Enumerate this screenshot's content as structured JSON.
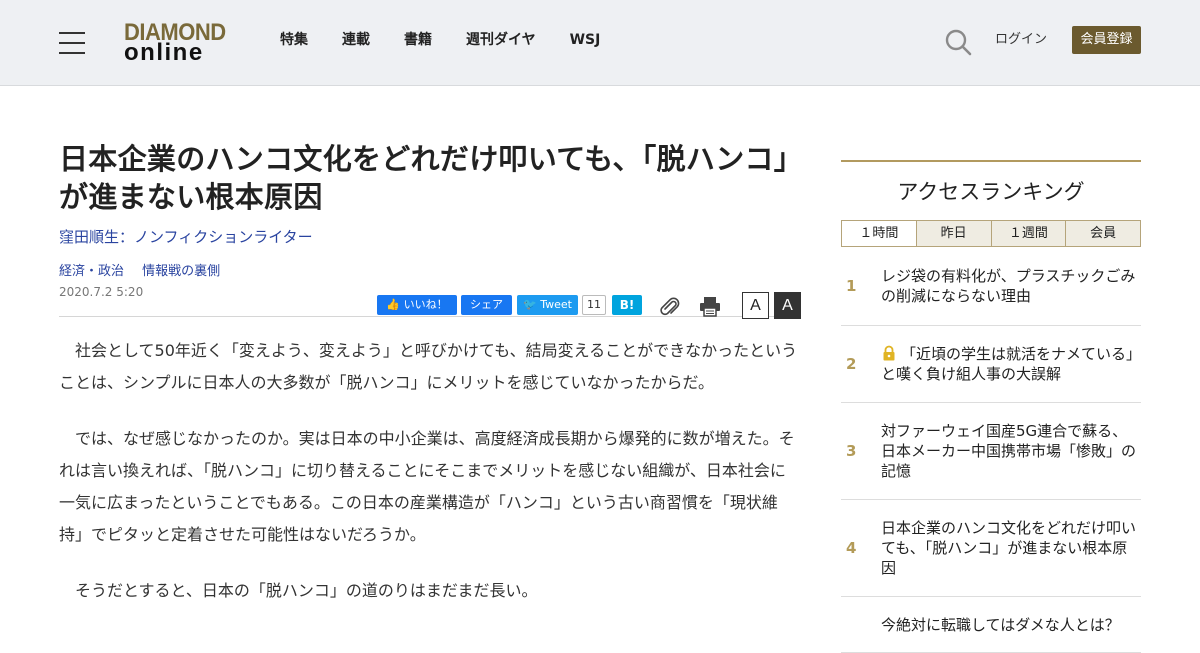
{
  "header": {
    "logo_top": "DIAMOND",
    "logo_bottom": "online",
    "nav": [
      "特集",
      "連載",
      "書籍",
      "週刊ダイヤ",
      "WSJ"
    ],
    "login": "ログイン",
    "register": "会員登録"
  },
  "article": {
    "title": "日本企業のハンコ文化をどれだけ叩いても、「脱ハンコ」が進まない根本原因",
    "author": "窪田順生：ノンフィクションライター",
    "tags": [
      "経済・政治",
      "情報戦の裏側"
    ],
    "date": "2020.7.2 5:20",
    "share": {
      "like": "いいね！",
      "fb_share": "シェア",
      "tweet": "Tweet",
      "tweet_count": "11",
      "hatena": "B!"
    },
    "font_size_small": "A",
    "font_size_large": "A",
    "paragraphs": [
      "社会として50年近く「変えよう、変えよう」と呼びかけても、結局変えることができなかったということは、シンプルに日本人の大多数が「脱ハンコ」にメリットを感じていなかったからだ。",
      "では、なぜ感じなかったのか。実は日本の中小企業は、高度経済成長期から爆発的に数が増えた。それは言い換えれば、「脱ハンコ」に切り替えることにそこまでメリットを感じない組織が、日本社会に一気に広まったということでもある。この日本の産業構造が「ハンコ」という古い商習慣を「現状維持」でピタッと定着させた可能性はないだろうか。",
      "そうだとすると、日本の「脱ハンコ」の道のりはまだまだ長い。"
    ]
  },
  "ranking": {
    "title": "アクセスランキング",
    "tabs": [
      "１時間",
      "昨日",
      "１週間",
      "会員"
    ],
    "active_tab": 0,
    "items": [
      {
        "rank": "1",
        "text": "レジ袋の有料化が、プラスチックごみの削減にならない理由",
        "locked": false
      },
      {
        "rank": "2",
        "text": "「近頃の学生は就活をナメている」と嘆く負け組人事の大誤解",
        "locked": true
      },
      {
        "rank": "3",
        "text": "対ファーウェイ国産5G連合で蘇る、日本メーカー中国携帯市場「惨敗」の記憶",
        "locked": false
      },
      {
        "rank": "4",
        "text": "日本企業のハンコ文化をどれだけ叩いても、「脱ハンコ」が進まない根本原因",
        "locked": false
      },
      {
        "rank": "5",
        "text": "今絶対に転職してはダメな人とは？",
        "locked": false
      }
    ]
  },
  "colors": {
    "header_bg": "#eef0f3",
    "brand_gold": "#6b5a2e",
    "link_blue": "#2a44a0",
    "rank_gold": "#b39b58"
  }
}
